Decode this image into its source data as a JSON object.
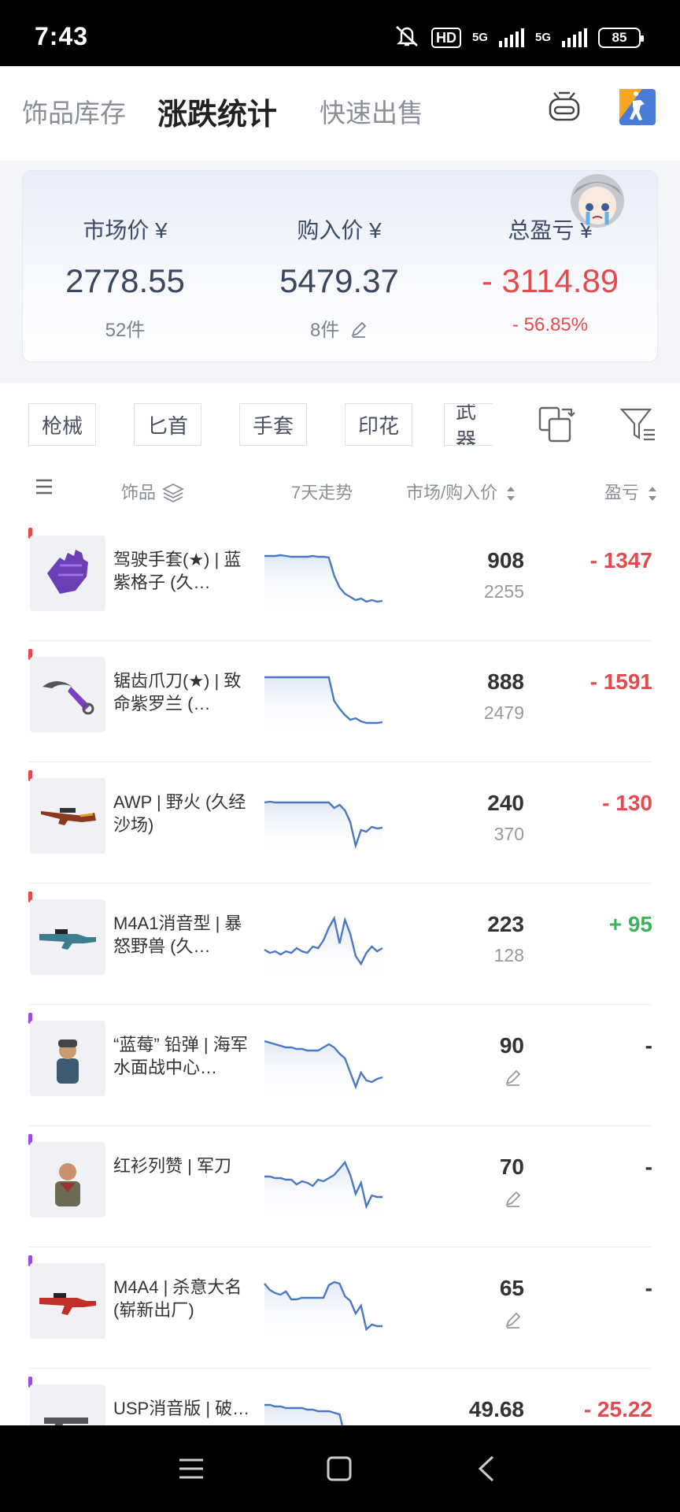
{
  "status_bar": {
    "time": "7:43",
    "hd": "HD",
    "net1": "5G",
    "net2": "5G",
    "battery": "85"
  },
  "tabs": [
    {
      "label": "饰品库存"
    },
    {
      "label": "涨跌统计"
    },
    {
      "label": "快速出售"
    }
  ],
  "summary": {
    "market": {
      "label": "市场价 ¥",
      "value": "2778.55",
      "sub": "52件"
    },
    "buy": {
      "label": "购入价 ¥",
      "value": "5479.37",
      "sub": "8件"
    },
    "total": {
      "label": "总盈亏 ¥",
      "value": "- 3114.89",
      "sub": "- 56.85%"
    }
  },
  "filters": [
    "枪械",
    "匕首",
    "手套",
    "印花",
    "武器"
  ],
  "table_header": {
    "item": "饰品",
    "trend": "7天走势",
    "price": "市场/购入价",
    "pl": "盈亏"
  },
  "colors": {
    "negative": "#e34b4f",
    "positive": "#3db35a",
    "spark": "#4a78c2"
  },
  "items": [
    {
      "name": "驾驶手套(★) | 蓝紫格子 (久…",
      "market": "908",
      "buy": "2255",
      "pl": "- 1347",
      "pl_type": "neg",
      "rarity": "#e44a4a",
      "thumb": "glove-icon",
      "trend": [
        70,
        70,
        70,
        71,
        70,
        69,
        69,
        69,
        69,
        70,
        69,
        69,
        68,
        45,
        30,
        22,
        18,
        14,
        16,
        12,
        14,
        12,
        13
      ]
    },
    {
      "name": "锯齿爪刀(★) | 致命紫罗兰 (…",
      "market": "888",
      "buy": "2479",
      "pl": "- 1591",
      "pl_type": "neg",
      "rarity": "#e44a4a",
      "thumb": "karambit-icon",
      "trend": [
        70,
        70,
        70,
        70,
        70,
        70,
        70,
        70,
        70,
        70,
        70,
        70,
        70,
        40,
        30,
        22,
        16,
        18,
        14,
        12,
        12,
        12,
        13
      ]
    },
    {
      "name": "AWP | 野火 (久经沙场)",
      "market": "240",
      "buy": "370",
      "pl": "- 130",
      "pl_type": "neg",
      "rarity": "#e44a4a",
      "thumb": "awp-icon",
      "trend": [
        65,
        66,
        65,
        65,
        65,
        65,
        65,
        65,
        65,
        65,
        65,
        65,
        65,
        58,
        62,
        55,
        40,
        10,
        30,
        28,
        34,
        32,
        33
      ]
    },
    {
      "name": "M4A1消音型 | 暴怒野兽 (久…",
      "market": "223",
      "buy": "128",
      "pl": "+ 95",
      "pl_type": "pos",
      "rarity": "#e44a4a",
      "thumb": "m4a1-icon",
      "trend": [
        32,
        28,
        30,
        26,
        30,
        28,
        34,
        30,
        28,
        36,
        34,
        44,
        60,
        72,
        40,
        70,
        52,
        24,
        14,
        28,
        36,
        30,
        34
      ]
    },
    {
      "name": "“蓝莓” 铅弹 | 海军水面战中心…",
      "market": "90",
      "buy": "",
      "pl": "-",
      "pl_type": "none",
      "rarity": "#9b4de0",
      "thumb": "agent-icon",
      "trend": [
        70,
        68,
        66,
        64,
        62,
        62,
        60,
        60,
        58,
        58,
        58,
        62,
        66,
        62,
        54,
        48,
        30,
        12,
        30,
        20,
        18,
        22,
        24
      ]
    },
    {
      "name": "红衫列赞 | 军刀",
      "market": "70",
      "buy": "",
      "pl": "-",
      "pl_type": "none",
      "rarity": "#9b4de0",
      "thumb": "agent2-icon",
      "trend": [
        52,
        52,
        50,
        50,
        48,
        48,
        42,
        46,
        44,
        40,
        48,
        46,
        50,
        54,
        62,
        70,
        54,
        30,
        44,
        14,
        28,
        26,
        26
      ]
    },
    {
      "name": "M4A4 | 杀意大名 (崭新出厂)",
      "market": "65",
      "buy": "",
      "pl": "-",
      "pl_type": "none",
      "rarity": "#9b4de0",
      "thumb": "m4a4-icon",
      "trend": [
        70,
        62,
        58,
        56,
        60,
        50,
        50,
        52,
        52,
        52,
        52,
        52,
        68,
        72,
        70,
        54,
        48,
        32,
        42,
        12,
        18,
        16,
        16
      ]
    },
    {
      "name": "USP消音版 | 破…",
      "market": "49.68",
      "buy": "",
      "pl": "- 25.22",
      "pl_type": "neg",
      "rarity": "#9b4de0",
      "thumb": "usp-icon",
      "trend": [
        70,
        70,
        68,
        68,
        66,
        66,
        66,
        66,
        64,
        64,
        62,
        62,
        62,
        60,
        58,
        30,
        20,
        10,
        12,
        12,
        12,
        12,
        12
      ]
    }
  ]
}
